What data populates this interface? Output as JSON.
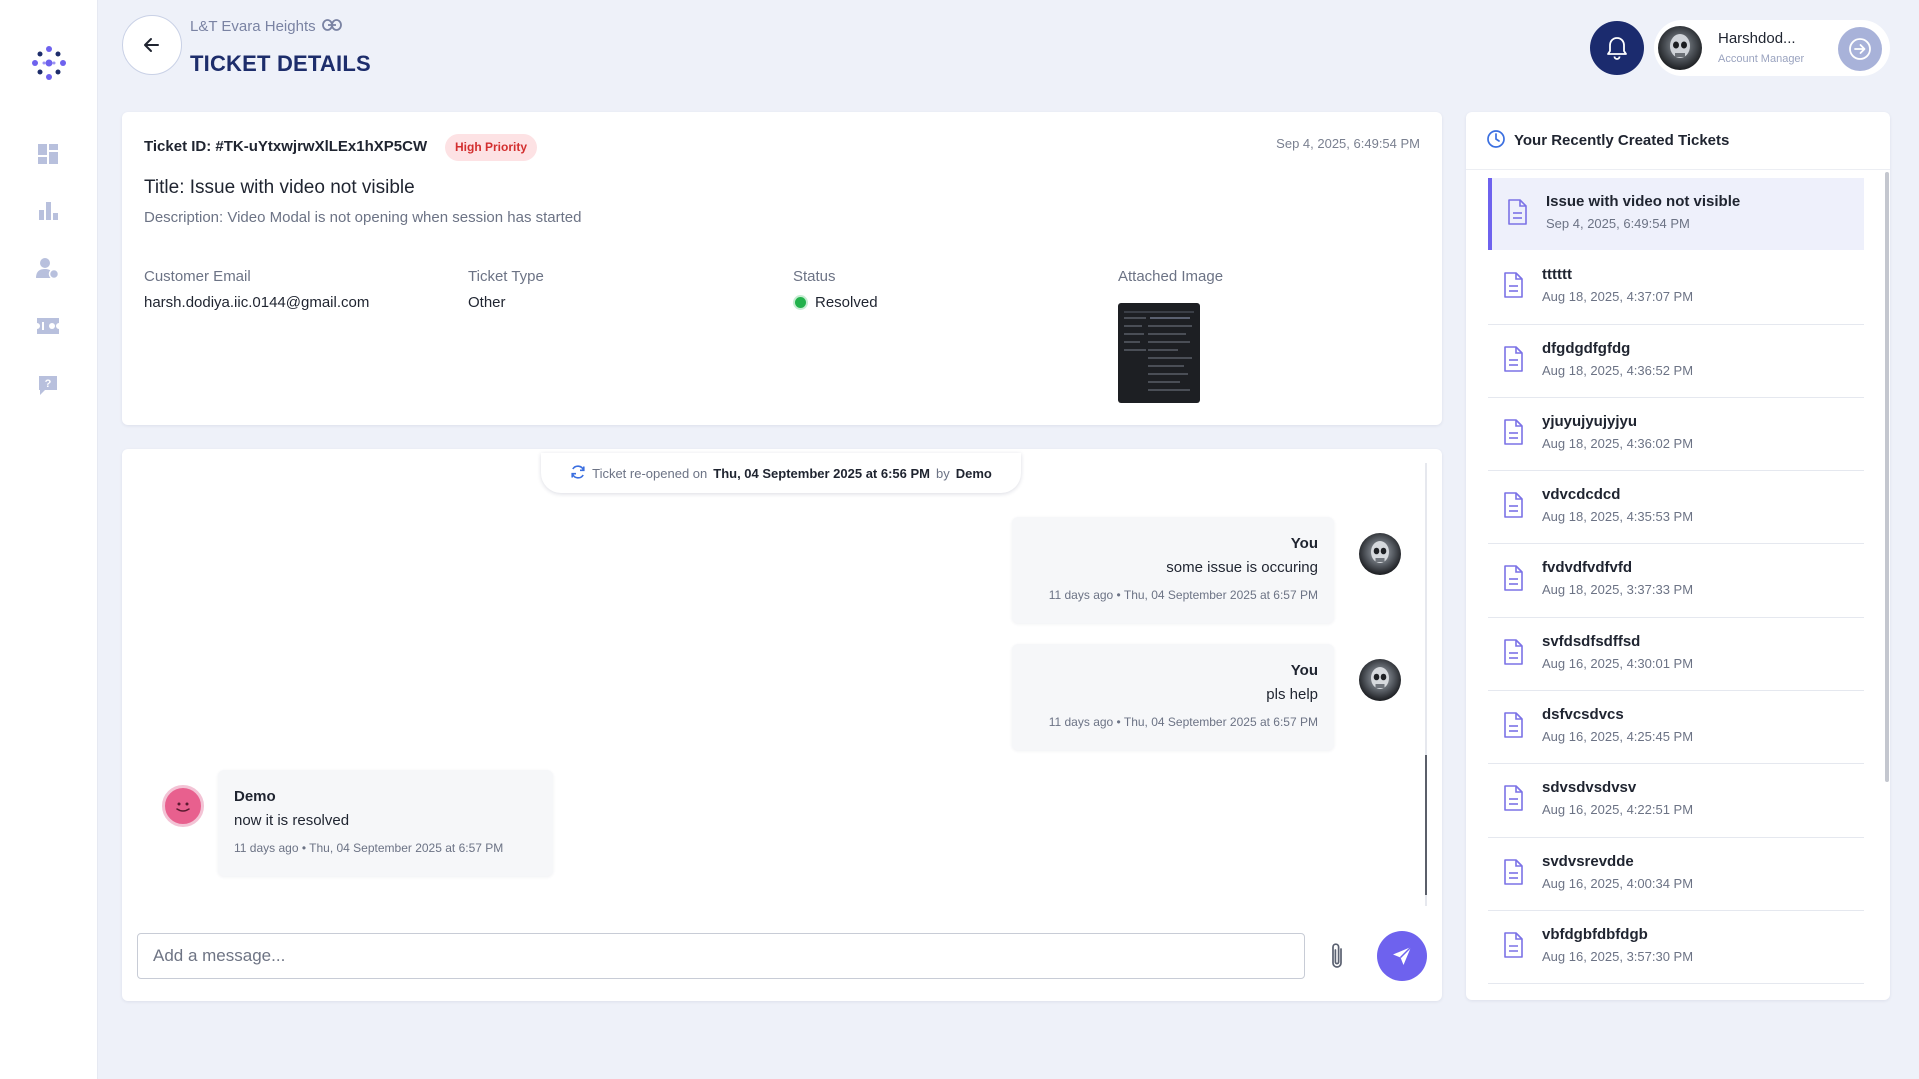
{
  "header": {
    "project_name": "L&T Evara Heights",
    "page_title": "TICKET DETAILS",
    "user_name": "Harshdod...",
    "user_role": "Account Manager"
  },
  "ticket": {
    "id_text": "Ticket ID: #TK-uYtxwjrwXlLEx1hXP5CW",
    "priority": "High Priority",
    "date": "Sep 4, 2025, 6:49:54 PM",
    "title": "Title: Issue with video not visible",
    "description": "Description: Video Modal is not opening when session has started",
    "fields": {
      "email_label": "Customer Email",
      "email_value": "harsh.dodiya.iic.0144@gmail.com",
      "type_label": "Ticket Type",
      "type_value": "Other",
      "status_label": "Status",
      "status_value": "Resolved",
      "image_label": "Attached Image"
    }
  },
  "chat": {
    "reopen": {
      "prefix": "Ticket re-opened on",
      "when": "Thu, 04 September 2025 at 6:56 PM",
      "by_word": "by",
      "by": "Demo"
    },
    "messages": [
      {
        "name": "You",
        "text": "some issue is occuring",
        "time": "11 days ago • Thu, 04 September 2025 at 6:57 PM"
      },
      {
        "name": "You",
        "text": "pls help",
        "time": "11 days ago • Thu, 04 September 2025 at 6:57 PM"
      },
      {
        "name": "Demo",
        "text": "now it is resolved",
        "time": "11 days ago • Thu, 04 September 2025 at 6:57 PM"
      }
    ],
    "input_placeholder": "Add a message..."
  },
  "recent": {
    "title": "Your Recently Created Tickets",
    "items": [
      {
        "title": "Issue with video not visible",
        "date": "Sep 4, 2025, 6:49:54 PM"
      },
      {
        "title": "tttttt",
        "date": "Aug 18, 2025, 4:37:07 PM"
      },
      {
        "title": "dfgdgdfgfdg",
        "date": "Aug 18, 2025, 4:36:52 PM"
      },
      {
        "title": "yjuyujyujyjyu",
        "date": "Aug 18, 2025, 4:36:02 PM"
      },
      {
        "title": "vdvcdcdcd",
        "date": "Aug 18, 2025, 4:35:53 PM"
      },
      {
        "title": "fvdvdfvdfvfd",
        "date": "Aug 18, 2025, 3:37:33 PM"
      },
      {
        "title": "svfdsdfsdffsd",
        "date": "Aug 16, 2025, 4:30:01 PM"
      },
      {
        "title": "dsfvcsdvcs",
        "date": "Aug 16, 2025, 4:25:45 PM"
      },
      {
        "title": "sdvsdvsdvsv",
        "date": "Aug 16, 2025, 4:22:51 PM"
      },
      {
        "title": "svdvsrevdde",
        "date": "Aug 16, 2025, 4:00:34 PM"
      },
      {
        "title": "vbfdgbfdbfdgb",
        "date": "Aug 16, 2025, 3:57:30 PM"
      }
    ]
  },
  "colors": {
    "accent": "#6e62ee",
    "navy": "#1d2d6b",
    "priority_bg": "#fde2e4",
    "priority_text": "#d32f2f",
    "status_resolved": "#22b24c"
  },
  "icons": {
    "sidebar": [
      "dashboard-icon",
      "bar-chart-icon",
      "user-settings-icon",
      "ticket-icon",
      "help-icon"
    ]
  }
}
